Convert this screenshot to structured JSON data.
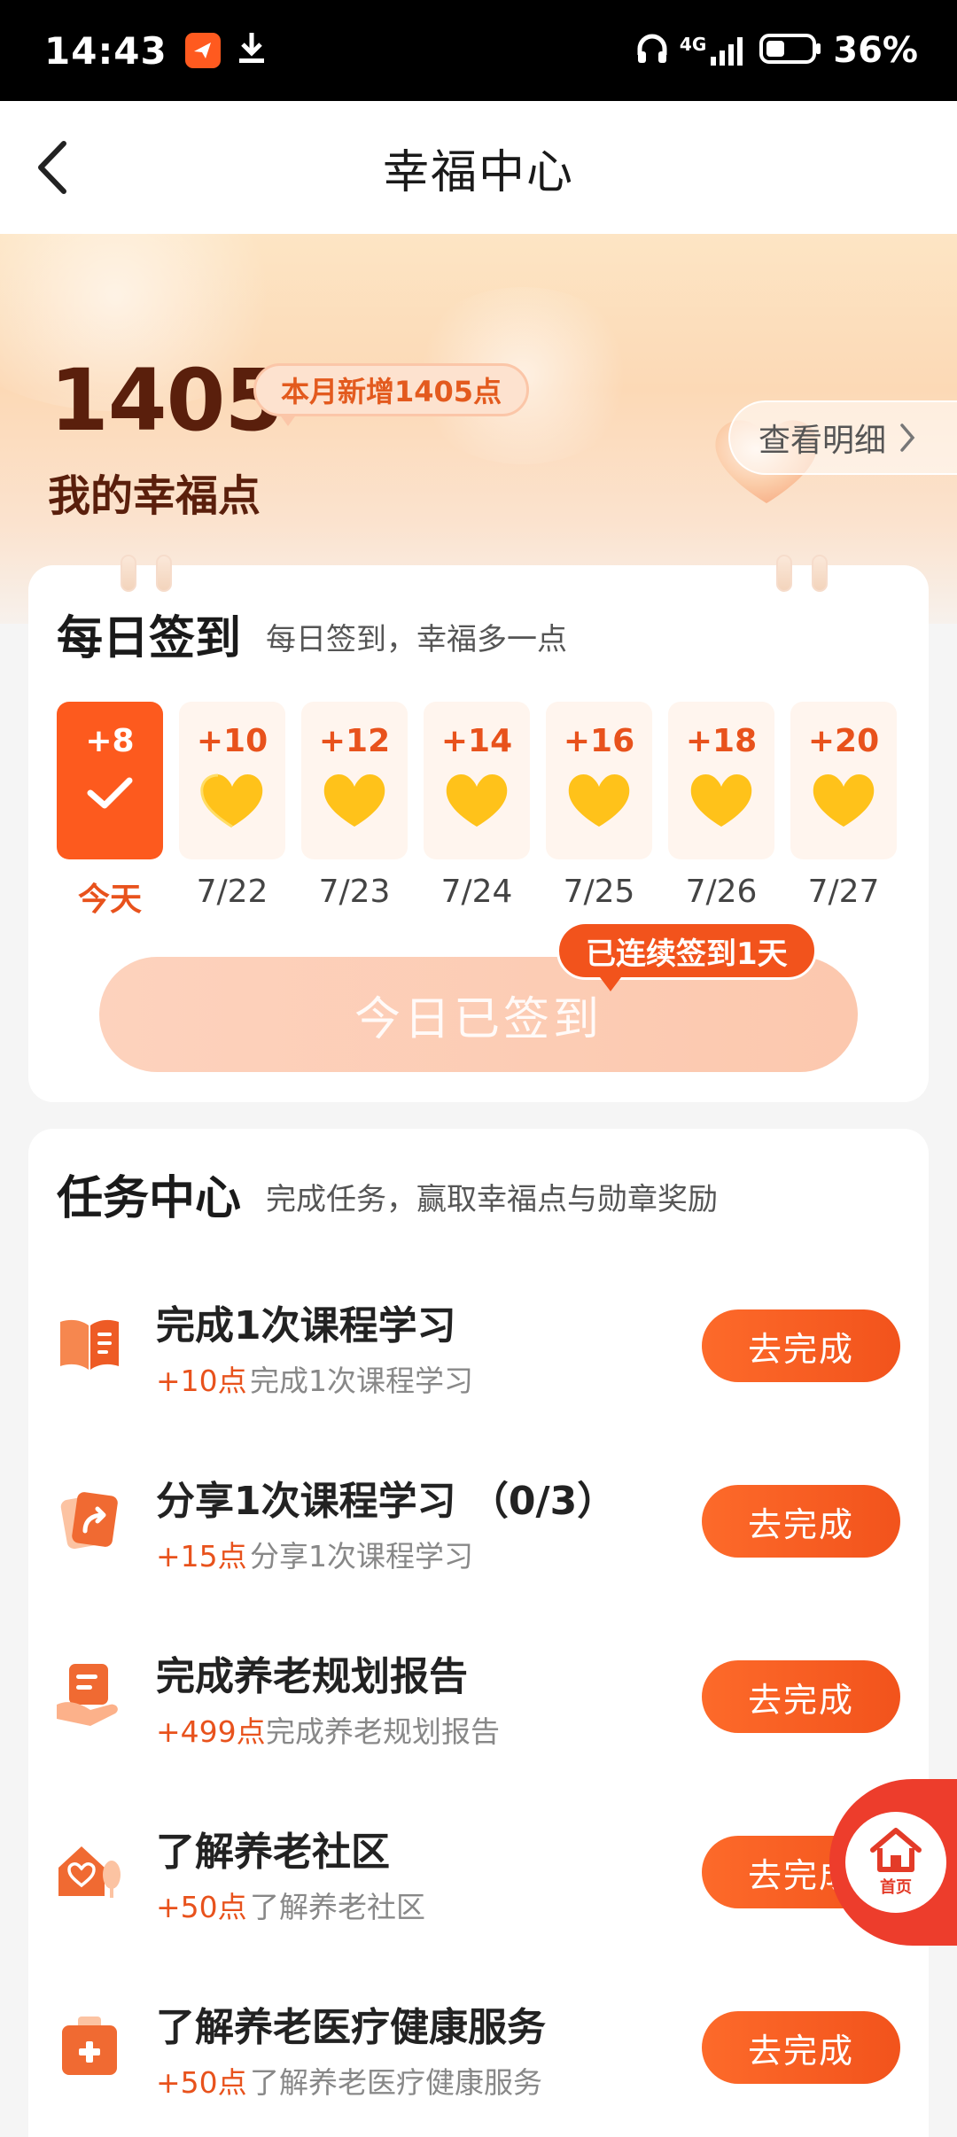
{
  "status_bar": {
    "time": "14:43",
    "network": "4G",
    "battery": "36%"
  },
  "nav": {
    "title": "幸福中心"
  },
  "hero": {
    "points": "1405",
    "monthly_badge": "本月新增1405点",
    "points_label": "我的幸福点",
    "detail_button": "查看明细"
  },
  "checkin": {
    "title": "每日签到",
    "subtitle": "每日签到，幸福多一点",
    "days": [
      {
        "points": "+8",
        "label": "今天",
        "today": true
      },
      {
        "points": "+10",
        "label": "7/22",
        "today": false
      },
      {
        "points": "+12",
        "label": "7/23",
        "today": false
      },
      {
        "points": "+14",
        "label": "7/24",
        "today": false
      },
      {
        "points": "+16",
        "label": "7/25",
        "today": false
      },
      {
        "points": "+18",
        "label": "7/26",
        "today": false
      },
      {
        "points": "+20",
        "label": "7/27",
        "today": false
      }
    ],
    "button": "今日已签到",
    "streak": "已连续签到1天"
  },
  "tasks": {
    "title": "任务中心",
    "subtitle": "完成任务，赢取幸福点与勋章奖励",
    "items": [
      {
        "title": "完成1次课程学习",
        "points": "+10点",
        "desc": "完成1次课程学习",
        "button": "去完成",
        "icon": "book-icon"
      },
      {
        "title": "分享1次课程学习 （0/3）",
        "points": "+15点",
        "desc": "分享1次课程学习",
        "button": "去完成",
        "icon": "share-icon"
      },
      {
        "title": "完成养老规划报告",
        "points": "+499点",
        "desc": "完成养老规划报告",
        "button": "去完成",
        "icon": "report-icon"
      },
      {
        "title": "了解养老社区",
        "points": "+50点",
        "desc": "了解养老社区",
        "button": "去完成",
        "icon": "community-icon"
      },
      {
        "title": "了解养老医疗健康服务",
        "points": "+50点",
        "desc": "了解养老医疗健康服务",
        "button": "去完成",
        "icon": "medical-kit-icon"
      }
    ]
  },
  "float_home": {
    "label": "首页"
  },
  "colors": {
    "accent": "#f2531c",
    "dark_brown": "#5a1f0c",
    "heart": "#ffc21a"
  }
}
